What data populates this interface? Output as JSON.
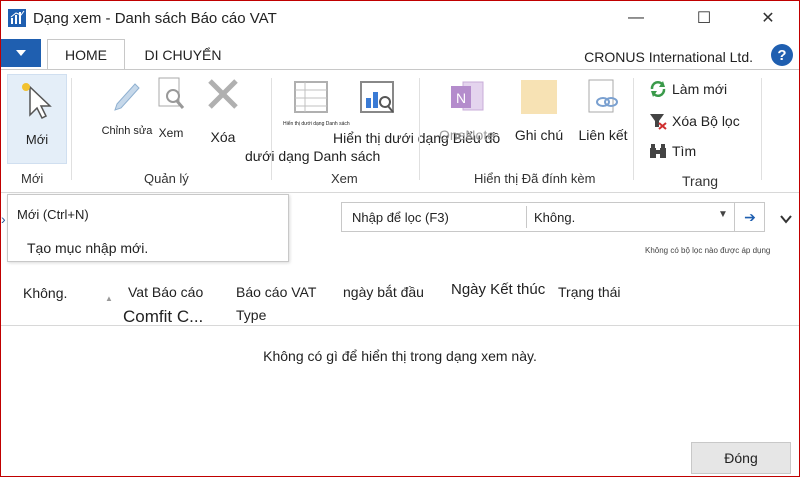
{
  "window": {
    "title": "Dạng xem - Danh sách Báo cáo VAT",
    "minimize": "—",
    "maximize": "☐",
    "close": "✕"
  },
  "tabs": [
    {
      "label": "HOME"
    },
    {
      "label": "DI CHUYỂN"
    }
  ],
  "company": "CRONUS International Ltd.",
  "help": "?",
  "ribbon": {
    "new": {
      "label": "Mới",
      "group": "Mới"
    },
    "manage": {
      "edit": "Chỉnh sửa",
      "view": "Xem",
      "delete": "Xóa",
      "group": "Quản lý"
    },
    "view": {
      "list_tiny": "Hiển thị dưới dạng Danh sách",
      "list": "dưới dạng Danh sách",
      "chart": "Hiển thị dưới dạng Biểu đồ",
      "group": "Xem"
    },
    "attach": {
      "onenote": "OneNote",
      "notes": "Ghi chú",
      "links": "Liên kết",
      "group": "Hiển thị Đã đính kèm"
    },
    "page": {
      "refresh": "Làm mới",
      "clear_filter": "Xóa Bộ lọc",
      "find": "Tìm",
      "group": "Trang"
    }
  },
  "tooltip": {
    "title": "Mới (Ctrl+N)",
    "description": "Tạo mục nhập mới."
  },
  "filter": {
    "field": "Nhập để lọc (F3)",
    "value": "Không.",
    "note": "Không có bộ lọc nào được áp dụng"
  },
  "columns": {
    "no": "Không.",
    "vat_report_1": "Vat Báo cáo",
    "vat_report_2": "Comfit C...",
    "type_1": "Báo cáo VAT",
    "type_2": "Type",
    "start": "ngày bắt đầu",
    "end": "Ngày Kết thúc",
    "status": "Trạng thái"
  },
  "empty_message": "Không có gì để hiển thị trong dạng xem này.",
  "close_button": "Đóng",
  "colors": {
    "accent": "#1f5fb0",
    "window_border": "#c00000"
  }
}
